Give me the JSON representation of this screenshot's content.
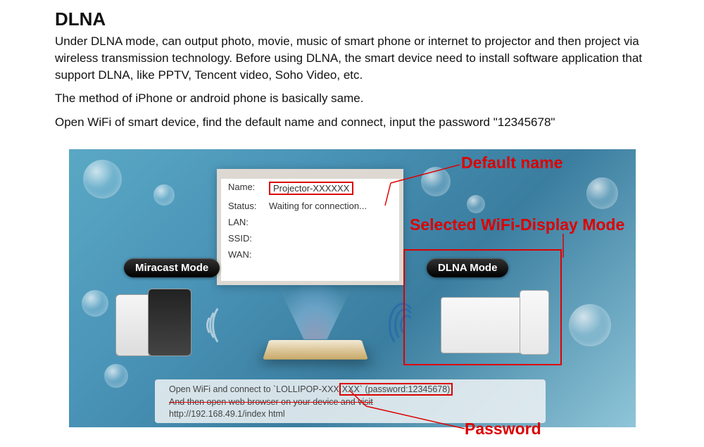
{
  "title": "DLNA",
  "paragraphs": [
    "  Under DLNA mode, can output photo, movie, music of smart phone or internet to projector and then project via wireless transmission technology. Before using DLNA, the smart device need to install software application that support DLNA, like PPTV, Tencent video, Soho Video, etc.",
    "The method of iPhone or android phone is basically same.",
    "Open WiFi of smart device, find the default name and connect, input the password  \"12345678\""
  ],
  "screen": {
    "name_label": "Name:",
    "name_value": "Projector-XXXXXX",
    "status_label": "Status:",
    "status_value": "Waiting for connection...",
    "lan_label": "LAN:",
    "ssid_label": "SSID:",
    "wan_label": "WAN:"
  },
  "modes": {
    "miracast": "Miracast Mode",
    "dlna": "DLNA Mode"
  },
  "bottom_text": {
    "line1_a": "Open WiFi and connect to `LOLLIPOP-XXX",
    "line1_b": "XXX` (password:12345678)",
    "line2": "And then open web browser on your device and visit",
    "line3": "http://192.168.49.1/index html"
  },
  "annotations": {
    "default_name": "Default name",
    "selected_mode": "Selected WiFi-Display Mode",
    "password": "Password"
  }
}
